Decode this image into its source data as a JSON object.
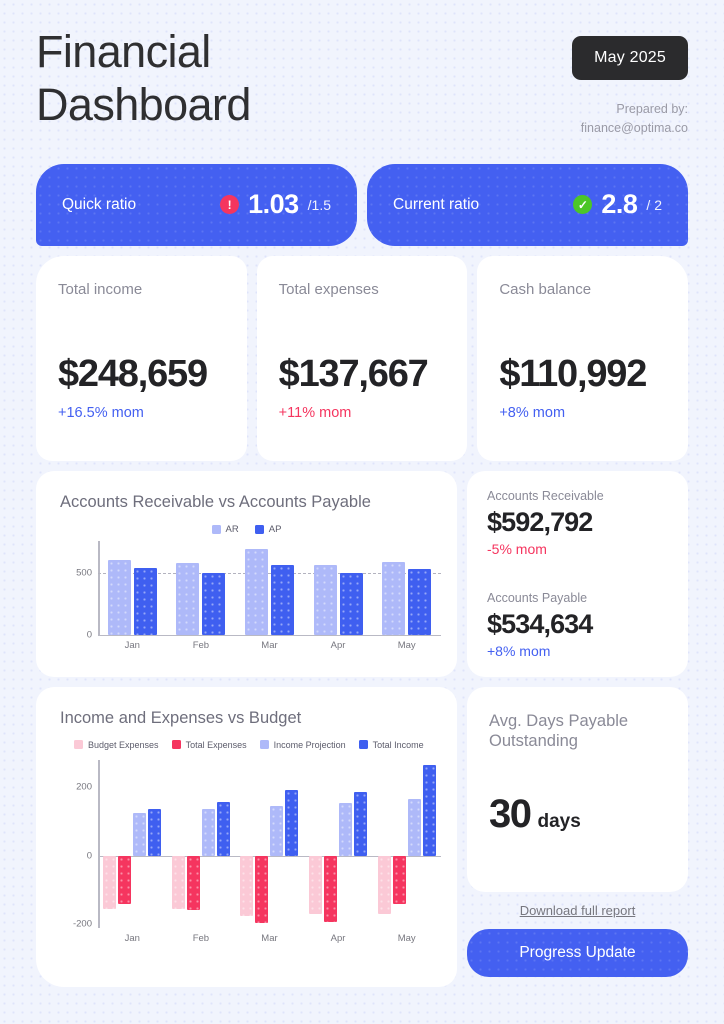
{
  "header": {
    "title_line1": "Financial",
    "title_line2": "Dashboard",
    "date_badge": "May 2025",
    "prepared_by_label": "Prepared by:",
    "prepared_by_email": "finance@optima.co"
  },
  "ratios": [
    {
      "label": "Quick ratio",
      "icon": "alert-icon",
      "status": "alert",
      "value": "1.03",
      "target": "/1.5"
    },
    {
      "label": "Current ratio",
      "icon": "check-icon",
      "status": "ok",
      "value": "2.8",
      "target": "/ 2"
    }
  ],
  "kpis": [
    {
      "label": "Total income",
      "value": "$248,659",
      "delta": "+16.5% mom",
      "delta_dir": "up"
    },
    {
      "label": "Total expenses",
      "value": "$137,667",
      "delta": "+11% mom",
      "delta_dir": "down"
    },
    {
      "label": "Cash balance",
      "value": "$110,992",
      "delta": "+8% mom",
      "delta_dir": "up"
    }
  ],
  "ar_ap_panel": {
    "receivable_label": "Accounts Receivable",
    "receivable_value": "$592,792",
    "receivable_delta": "-5% mom",
    "receivable_delta_dir": "down",
    "payable_label": "Accounts Payable",
    "payable_value": "$534,634",
    "payable_delta": "+8% mom",
    "payable_delta_dir": "up"
  },
  "dpo_panel": {
    "label": "Avg. Days Payable Outstanding",
    "value": "30",
    "unit": "days",
    "download_label": "Download full report",
    "cta_label": "Progress Update"
  },
  "colors": {
    "accent_blue": "#4460f1",
    "light_blue": "#aeb9f9",
    "hot_pink": "#f5355f",
    "pale_pink": "#fbc9d6",
    "alert_red": "#f5355f",
    "ok_green": "#4cc627",
    "badge_dark": "#2b2b2d",
    "page_background": "#f1f4fd"
  },
  "chart_data": [
    {
      "type": "bar",
      "title": "Accounts Receivable vs Accounts Payable",
      "categories": [
        "Jan",
        "Feb",
        "Mar",
        "Apr",
        "May"
      ],
      "series": [
        {
          "name": "AR",
          "color": "#aeb9f9",
          "values": [
            600,
            580,
            690,
            560,
            590
          ]
        },
        {
          "name": "AP",
          "color": "#3f5ff0",
          "values": [
            540,
            500,
            560,
            500,
            530
          ]
        }
      ],
      "ylabel": "",
      "xlabel": "",
      "ylim": [
        0,
        760
      ],
      "yticks": [
        0,
        500
      ],
      "ytick_labels": [
        "0",
        "500"
      ],
      "gridlines": [
        500
      ],
      "grid": true,
      "legend_position": "top-center"
    },
    {
      "type": "bar",
      "title": "Income and Expenses vs Budget",
      "categories": [
        "Jan",
        "Feb",
        "Mar",
        "Apr",
        "May"
      ],
      "series": [
        {
          "name": "Budget Expenses",
          "color": "#fbc9d6",
          "values": [
            -155,
            -155,
            -175,
            -172,
            -172
          ]
        },
        {
          "name": "Total Expenses",
          "color": "#f5355f",
          "values": [
            -140,
            -160,
            -197,
            -195,
            -142
          ]
        },
        {
          "name": "Income Projection",
          "color": "#aeb9f9",
          "values": [
            125,
            135,
            145,
            152,
            165
          ]
        },
        {
          "name": "Total Income",
          "color": "#3f5ff0",
          "values": [
            135,
            157,
            190,
            185,
            265
          ]
        }
      ],
      "ylabel": "",
      "xlabel": "",
      "ylim": [
        -210,
        280
      ],
      "yticks": [
        -200,
        0,
        200
      ],
      "ytick_labels": [
        "-200",
        "0",
        "200"
      ],
      "grid": false,
      "legend_position": "top-left"
    }
  ]
}
